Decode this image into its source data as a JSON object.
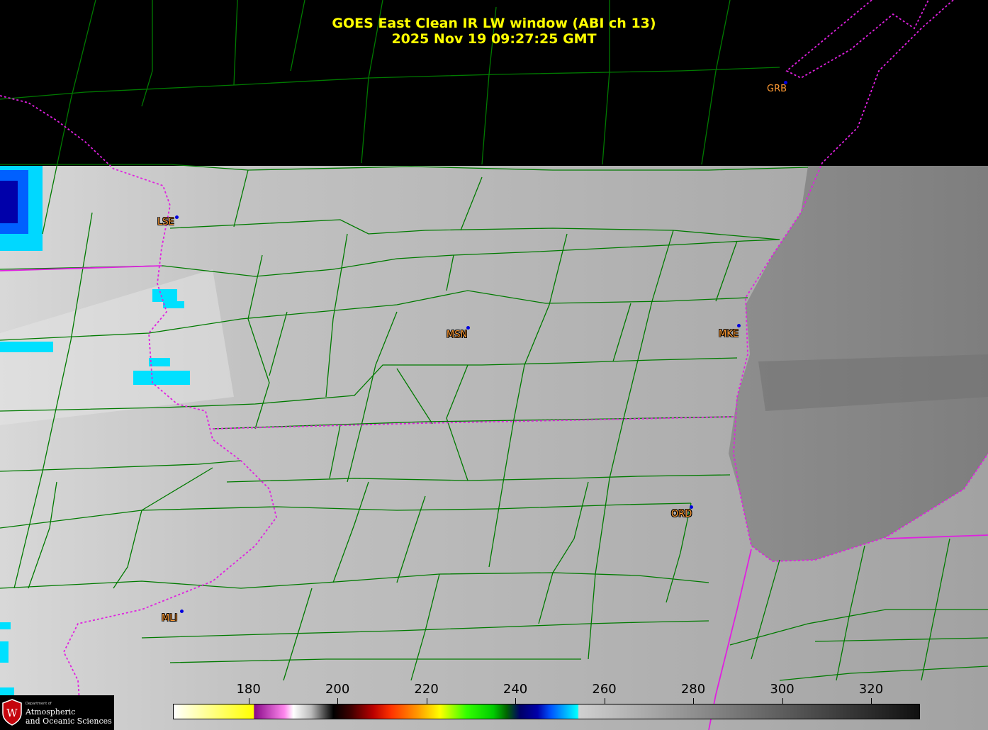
{
  "title": {
    "line1": "GOES East Clean IR LW window (ABI ch 13)",
    "line2": "2025 Nov 19  09:27:25 GMT"
  },
  "stations": [
    {
      "id": "GRB",
      "outlined": false
    },
    {
      "id": "LSE",
      "outlined": true
    },
    {
      "id": "MSN",
      "outlined": true
    },
    {
      "id": "MKE",
      "outlined": true
    },
    {
      "id": "ORD",
      "outlined": true
    },
    {
      "id": "MLI",
      "outlined": true
    }
  ],
  "colorbar": {
    "ticks": [
      "180",
      "200",
      "220",
      "240",
      "260",
      "280",
      "300",
      "320"
    ],
    "range": [
      163,
      331
    ],
    "stops": [
      {
        "value": 163,
        "color": "#ffffff"
      },
      {
        "value": 181,
        "color": "#ffff00"
      },
      {
        "value": 181.2,
        "color": "#8a0a8a"
      },
      {
        "value": 188,
        "color": "#ff88ee"
      },
      {
        "value": 190,
        "color": "#ffffff"
      },
      {
        "value": 194,
        "color": "#bbbbbb"
      },
      {
        "value": 199,
        "color": "#000000"
      },
      {
        "value": 203,
        "color": "#400000"
      },
      {
        "value": 208,
        "color": "#bb0000"
      },
      {
        "value": 212,
        "color": "#ff3300"
      },
      {
        "value": 218,
        "color": "#ff9900"
      },
      {
        "value": 223,
        "color": "#ffff00"
      },
      {
        "value": 229,
        "color": "#33ff00"
      },
      {
        "value": 235,
        "color": "#00cc00"
      },
      {
        "value": 238,
        "color": "#006600"
      },
      {
        "value": 241,
        "color": "#000066"
      },
      {
        "value": 245,
        "color": "#0000aa"
      },
      {
        "value": 248,
        "color": "#0055ff"
      },
      {
        "value": 254,
        "color": "#00ffff"
      },
      {
        "value": 254.3,
        "color": "#d0d0d0"
      },
      {
        "value": 331,
        "color": "#101010"
      }
    ]
  },
  "colors": {
    "boundary_county": "#007a00",
    "boundary_state": "#e020e0",
    "title": "#ffff00",
    "station_label": "#ff9a33",
    "station_dot": "#0000e0",
    "no_data": "#000000"
  },
  "logo": {
    "dept": "Department of",
    "line1": "Atmospheric",
    "line2": "and Oceanic Sciences"
  }
}
